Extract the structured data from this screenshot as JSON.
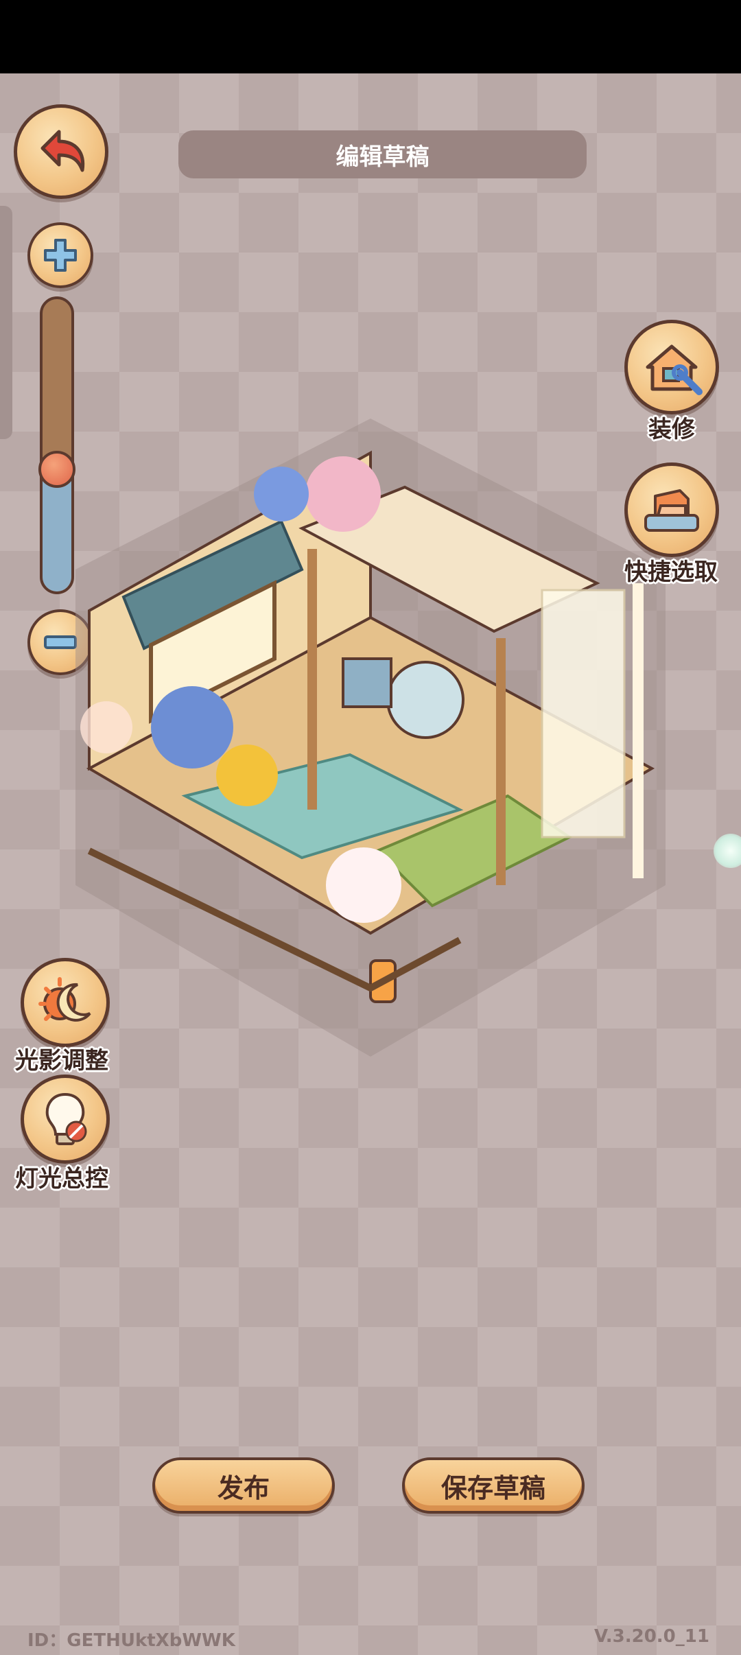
{
  "header": {
    "title": "编辑草稿"
  },
  "toolbar": {
    "back_icon": "back-arrow-icon",
    "zoom_in_icon": "plus-icon",
    "zoom_out_icon": "minus-icon",
    "zoom_level": 0.42
  },
  "right_actions": [
    {
      "label": "装修",
      "icon": "house-wrench-icon"
    },
    {
      "label": "快捷选取",
      "icon": "sofa-select-icon"
    }
  ],
  "left_actions": [
    {
      "label": "光影调整",
      "icon": "sun-moon-icon"
    },
    {
      "label": "灯光总控",
      "icon": "lightbulb-icon"
    }
  ],
  "bottom": {
    "publish_label": "发布",
    "save_label": "保存草稿"
  },
  "footer": {
    "id_text": "ID：GETHUktXbWWK",
    "version": "V.3.20.0_11"
  },
  "colors": {
    "button_fill": "#f3c688",
    "outline": "#5c3a2e",
    "title_pill": "#9a8582",
    "zoom_fill": "#8fb1c9"
  }
}
